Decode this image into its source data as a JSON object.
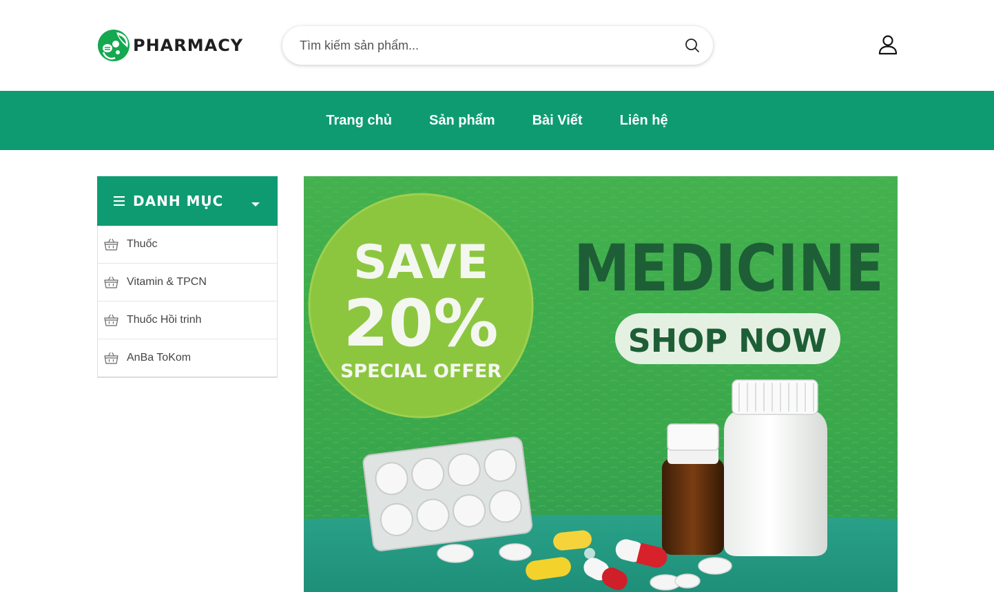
{
  "brand": {
    "name": "PHARMACY"
  },
  "search": {
    "placeholder": "Tìm kiếm sản phẩm..."
  },
  "nav": {
    "items": [
      {
        "label": "Trang chủ"
      },
      {
        "label": "Sản phẩm"
      },
      {
        "label": "Bài Viết"
      },
      {
        "label": "Liên hệ"
      }
    ]
  },
  "sidebar": {
    "title": "DANH MỤC",
    "items": [
      {
        "label": "Thuốc"
      },
      {
        "label": "Vitamin & TPCN"
      },
      {
        "label": "Thuốc Hồi trinh"
      },
      {
        "label": "AnBa ToKom"
      }
    ]
  },
  "banner": {
    "save": "SAVE",
    "discount": "20%",
    "offer": "SPECIAL OFFER",
    "headline": "MEDICINE",
    "cta": "SHOP NOW"
  },
  "colors": {
    "accent": "#0e9b72",
    "banner_bg": "#3bb04a",
    "badge": "#8cc63f",
    "headline": "#1e5e36"
  }
}
